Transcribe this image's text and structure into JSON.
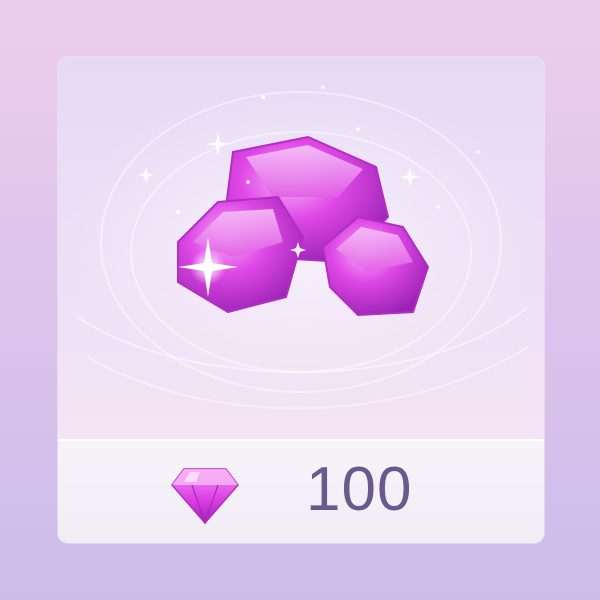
{
  "item": {
    "name": "gem-bundle",
    "icon": "gem-pile-icon",
    "price_currency_icon": "gem-icon",
    "price": "100"
  },
  "colors": {
    "gem": "#d63ae0",
    "gem_light": "#f59cf5",
    "gem_dark": "#8e1fa8",
    "price_text": "#6a5a8c",
    "background": "#dcc4ec"
  }
}
